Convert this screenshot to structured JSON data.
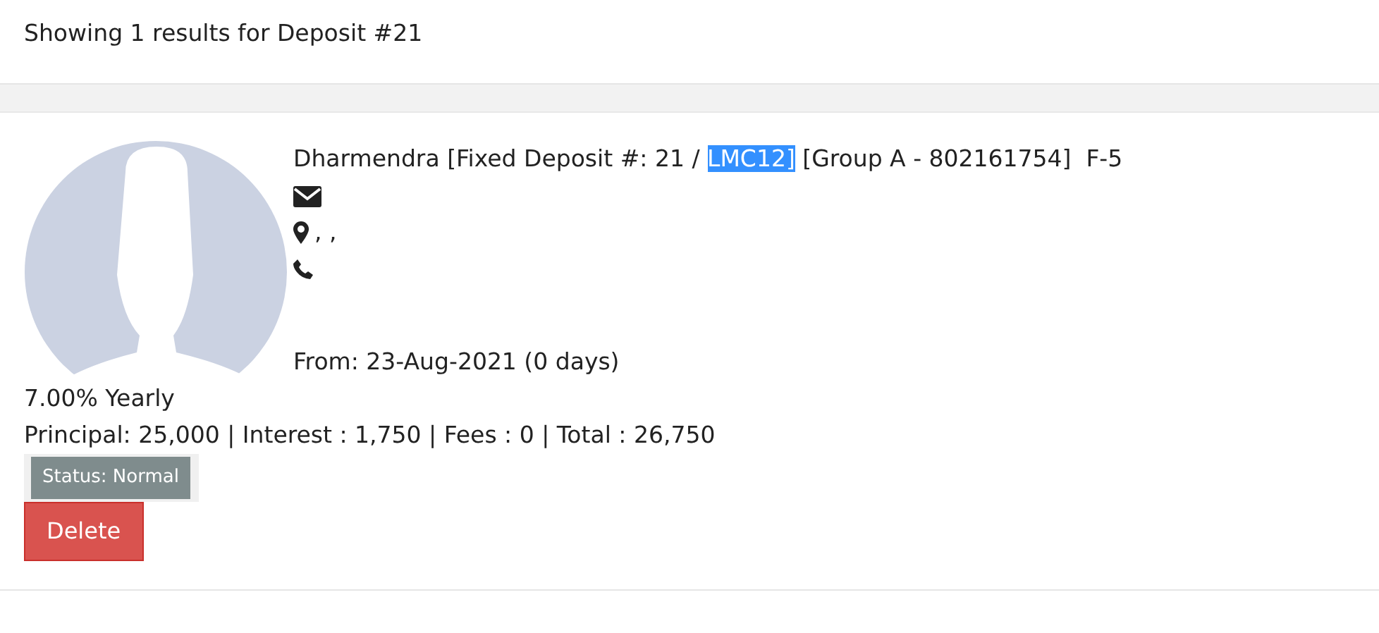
{
  "header": {
    "text": "Showing 1 results for Deposit #21"
  },
  "result": {
    "title": {
      "before": "Dharmendra [Fixed Deposit #: 21 / ",
      "selected_text": "LMC12]",
      "after": " [Group A - 802161754]  F-5"
    },
    "address": ", ,",
    "from": "From: 23-Aug-2021 (0 days)",
    "rate": "7.00% Yearly",
    "amounts": "Principal: 25,000 | Interest : 1,750 | Fees : 0 | Total : 26,750",
    "status": "Status: Normal",
    "button": "Delete"
  }
}
